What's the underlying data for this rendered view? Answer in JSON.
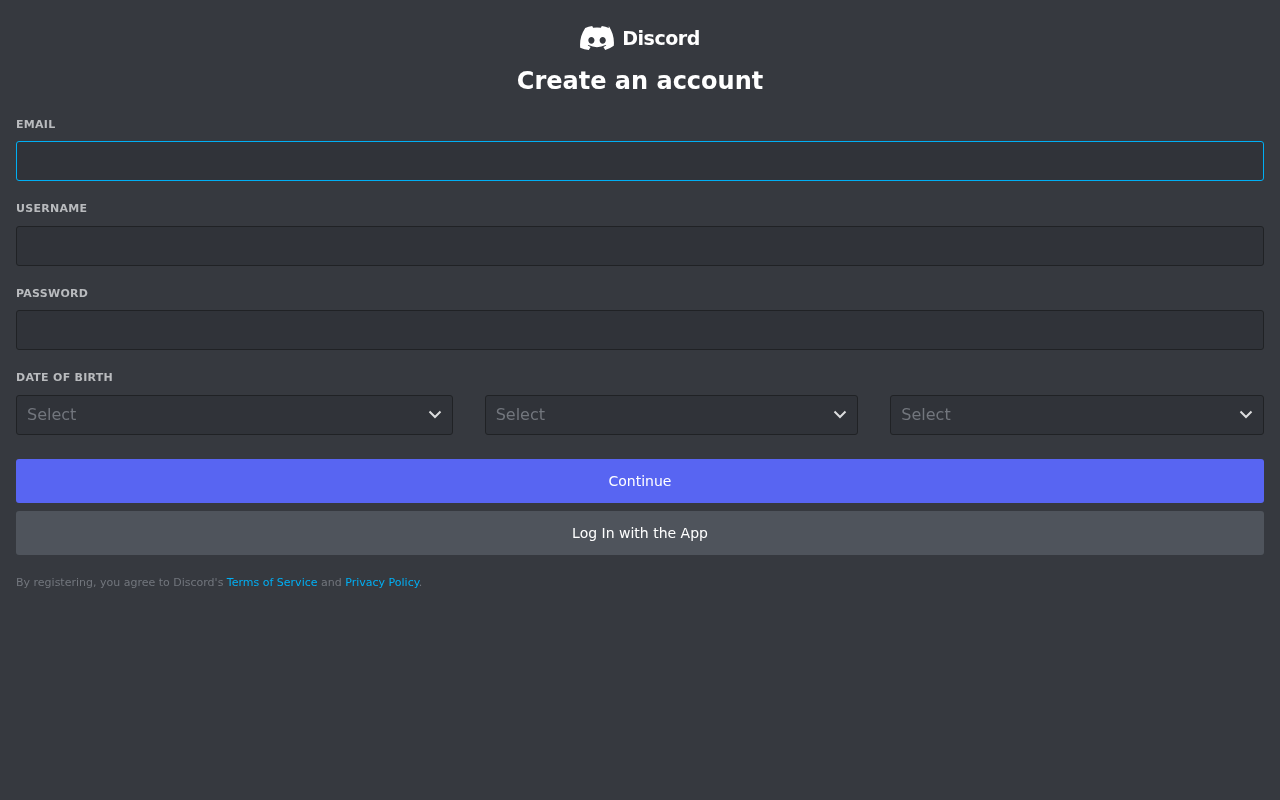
{
  "logo": {
    "text": "Discord"
  },
  "title": "Create an account",
  "fields": [
    {
      "label": "EMAIL",
      "focused": true
    },
    {
      "label": "USERNAME",
      "focused": false
    },
    {
      "label": "PASSWORD",
      "focused": false
    }
  ],
  "date_of_birth": {
    "label": "DATE OF BIRTH",
    "selects": [
      {
        "placeholder": "Select"
      },
      {
        "placeholder": "Select"
      },
      {
        "placeholder": "Select"
      }
    ]
  },
  "buttons": [
    {
      "label": "Continue",
      "kind": "primary"
    },
    {
      "label": "Log In with the App",
      "kind": "secondary"
    }
  ],
  "legal": [
    {
      "kind": "text",
      "text": "By registering, you agree to Discord's "
    },
    {
      "kind": "link",
      "text": "Terms of Service"
    },
    {
      "kind": "text",
      "text": " and "
    },
    {
      "kind": "link",
      "text": "Privacy Policy"
    },
    {
      "kind": "text",
      "text": "."
    }
  ]
}
